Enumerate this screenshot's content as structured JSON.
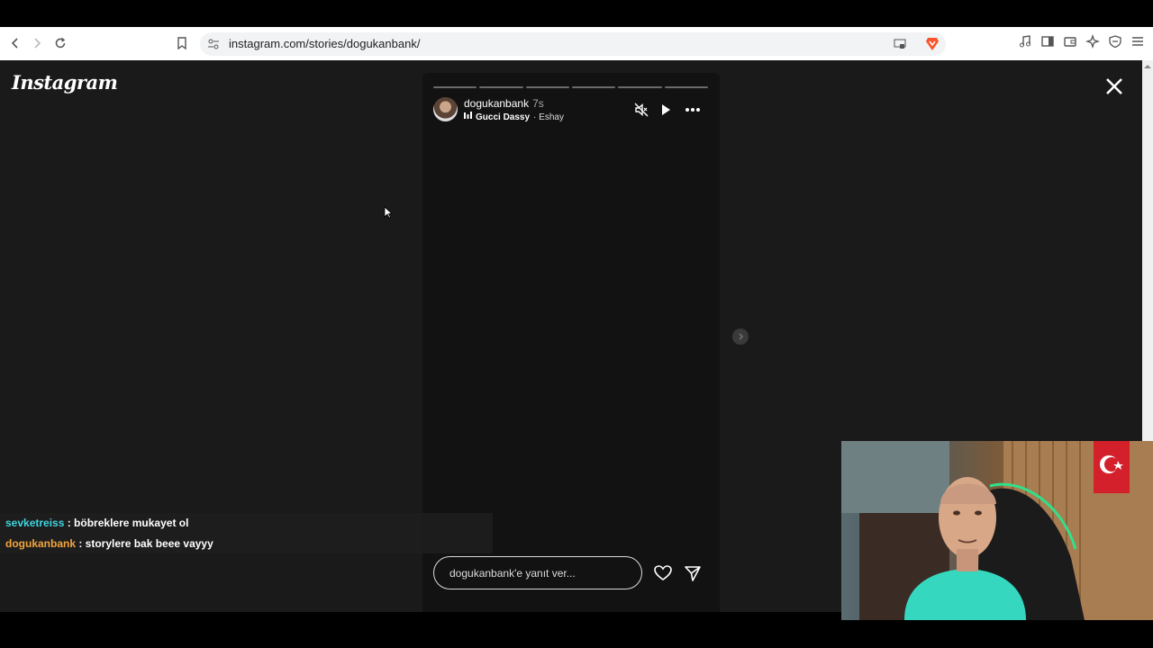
{
  "browser": {
    "url": "instagram.com/stories/dogukanbank/"
  },
  "instagram": {
    "logo": "Instagram",
    "story": {
      "username": "dogukanbank",
      "time": "7s",
      "song": "Gucci Dassy",
      "artist": "Eshay",
      "separator": " · ",
      "segments": 6,
      "reply_placeholder": "dogukanbank'e yanıt ver..."
    }
  },
  "chat": {
    "messages": [
      {
        "user": "sevketreiss",
        "text": " : böbreklere mukayet ol",
        "color": "#3fd5e0"
      },
      {
        "user": "dogukanbank",
        "text": " : storylere bak beee vayyy",
        "color": "#f2a53c"
      }
    ]
  },
  "icons": [
    "back-icon",
    "forward-icon",
    "reload-icon",
    "bookmark-icon",
    "site-settings-icon",
    "cast-icon",
    "brave-shield-icon",
    "media-icon",
    "sidebar-icon",
    "wallet-icon",
    "leo-ai-icon",
    "vpn-icon",
    "menu-icon",
    "close-icon",
    "mute-icon",
    "play-icon",
    "more-icon",
    "heart-icon",
    "share-icon",
    "next-story-icon"
  ]
}
